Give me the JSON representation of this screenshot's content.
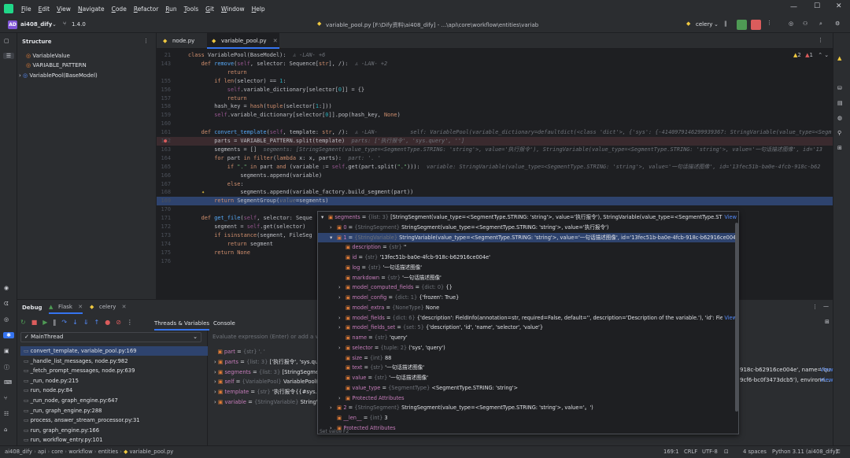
{
  "menu": [
    "File",
    "Edit",
    "View",
    "Navigate",
    "Code",
    "Refactor",
    "Run",
    "Tools",
    "Git",
    "Window",
    "Help"
  ],
  "project": {
    "badge": "AD",
    "name": "ai408_dify",
    "branch": "1.4.0"
  },
  "window_title": "variable_pool.py [F:\\Dify资料\\ai408_dify] - ...\\api\\core\\workflow\\entities\\variable_pool.py",
  "run_config": "celery",
  "colors": {
    "accent": "#3574f0",
    "breakpoint": "#db5c5c",
    "run_green": "#4e9a54",
    "stop_red": "#db5c5c"
  },
  "structure": {
    "title": "Structure",
    "items": [
      {
        "icon": "field-icon",
        "label": "VariableValue"
      },
      {
        "icon": "field-icon",
        "label": "VARIABLE_PATTERN"
      },
      {
        "icon": "class-icon",
        "label": "VariablePool(BaseModel)"
      }
    ]
  },
  "tabs": [
    {
      "label": "node.py"
    },
    {
      "label": "variable_pool.py"
    }
  ],
  "editor": {
    "warnings": "2",
    "errors": "1",
    "lines": [
      {
        "n": "21",
        "html": "<span class='kw'>class</span> VariablePool(BaseModel):  <span class='hint'>♙ -LAN- +6</span>"
      },
      {
        "n": "143",
        "html": "    <span class='kw'>def</span> <span class='fn'>remove</span>(<span class='sf'>self</span>, selector: Sequence[<span class='kw'>str</span>], /):  <span class='hint'>♙ -LAN- +2</span>"
      },
      {
        "n": "",
        "html": "            <span class='kw'>return</span>"
      },
      {
        "n": "155",
        "html": "        <span class='kw'>if</span> <span class='kw'>len</span>(selector) == <span class='nm'>1</span>:"
      },
      {
        "n": "156",
        "html": "            <span class='sf'>self</span>.variable_dictionary[selector[<span class='nm'>0</span>]] = {}"
      },
      {
        "n": "157",
        "html": "            <span class='kw'>return</span>"
      },
      {
        "n": "158",
        "html": "        hash_key = <span class='kw'>hash</span>(<span class='kw'>tuple</span>(selector[<span class='nm'>1</span>:]))"
      },
      {
        "n": "159",
        "html": "        <span class='sf'>self</span>.variable_dictionary[selector[<span class='nm'>0</span>]].pop(hash_key, <span class='kw'>None</span>)"
      },
      {
        "n": "160",
        "html": ""
      },
      {
        "n": "161",
        "html": "    <span class='kw'>def</span> <span class='fn'>convert_template</span>(<span class='sf'>self</span>, template: <span class='kw'>str</span>, /):  <span class='hint'>♙ -LAN-</span>          <span class='hint'>self: VariablePool(variable_dictionary=defaultdict(&lt;class 'dict'&gt;, {'sys': {-4140979146299939367: StringVariable(value_type=&lt;Segm</span>"
      },
      {
        "n": "162",
        "html": "        parts = VARIABLE_PATTERN.split(template)  <span class='hint'>parts: ['执行报令', 'sys.query', '']</span>",
        "cls": "hl",
        "bp": true
      },
      {
        "n": "163",
        "html": "        segments = []  <span class='hint'>segments: [StringSegment(value_type=&lt;SegmentType.STRING: 'string'&gt;, value='执行报令'), StringVariable(value_type=&lt;SegmentType.STRING: 'string'&gt;, value='一句话描述图像', id='13</span>"
      },
      {
        "n": "164",
        "html": "        <span class='kw'>for</span> part <span class='kw'>in</span> <span class='kw'>filter</span>(<span class='kw'>lambda</span> x: x, parts):  <span class='hint'>part: '. '</span>"
      },
      {
        "n": "165",
        "html": "            <span class='kw'>if</span> <span class='st'>\".\"</span> <span class='kw'>in</span> part <span class='kw'>and</span> (variable := <span class='sf'>self</span>.get(part.split(<span class='st'>\".\"</span>))):  <span class='hint'>variable: StringVariable(value_type=&lt;SegmentType.STRING: 'string'&gt;, value='一句话描述图像', id='13fec51b-ba0e-4fcb-918c-b62</span>"
      },
      {
        "n": "166",
        "html": "                segments.append(variable)"
      },
      {
        "n": "167",
        "html": "            <span class='kw'>else</span>:"
      },
      {
        "n": "168",
        "html": "                segments.append(variable_factory.build_segment(part))",
        "bulb": true
      },
      {
        "n": "169",
        "html": "        <span class='kw'>return</span> SegmentGroup(<span class='hint'>value</span>=segments)",
        "cls": "exec"
      },
      {
        "n": "170",
        "html": ""
      },
      {
        "n": "171",
        "html": "    <span class='kw'>def</span> <span class='fn'>get_file</span>(<span class='sf'>self</span>, selector: Seque"
      },
      {
        "n": "172",
        "html": "        segment = <span class='sf'>self</span>.get(selector)"
      },
      {
        "n": "173",
        "html": "        <span class='kw'>if</span> <span class='kw'>isinstance</span>(segment, FileSeg"
      },
      {
        "n": "174",
        "html": "            <span class='kw'>return</span> segment"
      },
      {
        "n": "175",
        "html": "        <span class='kw'>return</span> <span class='kw'>None</span>"
      },
      {
        "n": "176",
        "html": ""
      }
    ]
  },
  "debug": {
    "title": "Debug",
    "tabs": [
      {
        "label": "Flask"
      },
      {
        "label": "celery"
      }
    ],
    "subtabs": [
      "Threads & Variables",
      "Console"
    ],
    "thread": "MainThread",
    "eval_placeholder": "Evaluate expression (Enter) or add a watch (Ctrl+Shift+Enter)",
    "frames": [
      "convert_template, variable_pool.py:169",
      "_handle_list_messages, node.py:982",
      "_fetch_prompt_messages, node.py:639",
      "_run, node.py:215",
      "run, node.py:84",
      "_run_node, graph_engine.py:647",
      "_run, graph_engine.py:288",
      "process, answer_stream_processor.py:31",
      "run, graph_engine.py:166",
      "run, workflow_entry.py:101"
    ],
    "vars": [
      {
        "name": "part",
        "type": "{str} '. '",
        "value": ""
      },
      {
        "name": "parts",
        "type": "{list: 3}",
        "value": "['执行报令', 'sys.query', '']"
      },
      {
        "name": "segments",
        "type": "{list: 3}",
        "value": "[StringSegmen"
      },
      {
        "name": "self",
        "type": "{VariablePool}",
        "value": "VariablePool(\\"
      },
      {
        "name": "template",
        "type": "{str}",
        "value": "'执行报令{{#sys.que"
      },
      {
        "name": "variable",
        "type": "{StringVariable}",
        "value": "StringVar"
      }
    ],
    "vars_right": [
      {
        "value": "918c-b62916ce004e', name='qu",
        "view": "View"
      },
      {
        "value": "9cf6-bc0f3473dcb5'), environn...",
        "view": "View"
      }
    ]
  },
  "popup": {
    "rows": [
      {
        "indent": 0,
        "arrow": "▾",
        "name": "segments",
        "type": "{list: 3}",
        "value": "[StringSegment(value_type=<SegmentType.STRING: 'string'>, value='执行报令'), StringVariable(value_type=<SegmentType.STRING: 'string'...",
        "view": "View"
      },
      {
        "indent": 1,
        "arrow": "›",
        "name": "0",
        "type": "{StringSegment}",
        "value": "StringSegment(value_type=<SegmentType.STRING: 'string'>, value='执行报令')",
        "view": ""
      },
      {
        "indent": 1,
        "arrow": "▾",
        "name": "1",
        "type": "{StringVariable}",
        "value": "StringVariable(value_type=<SegmentType.STRING: 'string'>, value='一句话描述图像', id='13fec51b-ba0e-4fcb-918c-b62916ce004e', name='query'...",
        "view": "",
        "sel": true
      },
      {
        "indent": 2,
        "arrow": "",
        "name": "description",
        "type": "{str}",
        "value": "''",
        "view": ""
      },
      {
        "indent": 2,
        "arrow": "",
        "name": "id",
        "type": "{str}",
        "value": "'13fec51b-ba0e-4fcb-918c-b62916ce004e'",
        "view": ""
      },
      {
        "indent": 2,
        "arrow": "",
        "name": "log",
        "type": "{str}",
        "value": "'一句话描述图像'",
        "view": ""
      },
      {
        "indent": 2,
        "arrow": "",
        "name": "markdown",
        "type": "{str}",
        "value": "'一句话描述图像'",
        "view": ""
      },
      {
        "indent": 2,
        "arrow": "›",
        "name": "model_computed_fields",
        "type": "{dict: 0}",
        "value": "{}",
        "view": ""
      },
      {
        "indent": 2,
        "arrow": "›",
        "name": "model_config",
        "type": "{dict: 1}",
        "value": "{'frozen': True}",
        "view": ""
      },
      {
        "indent": 2,
        "arrow": "",
        "name": "model_extra",
        "type": "{NoneType}",
        "value": "None",
        "view": ""
      },
      {
        "indent": 2,
        "arrow": "›",
        "name": "model_fields",
        "type": "{dict: 6}",
        "value": "{'description': FieldInfo(annotation=str, required=False, default='', description='Description of the variable.'), 'id': FieldInfo(annota...",
        "view": "View"
      },
      {
        "indent": 2,
        "arrow": "›",
        "name": "model_fields_set",
        "type": "{set: 5}",
        "value": "{'description', 'id', 'name', 'selector', 'value'}",
        "view": ""
      },
      {
        "indent": 2,
        "arrow": "",
        "name": "name",
        "type": "{str}",
        "value": "'query'",
        "view": ""
      },
      {
        "indent": 2,
        "arrow": "›",
        "name": "selector",
        "type": "{tuple: 2}",
        "value": "('sys', 'query')",
        "view": ""
      },
      {
        "indent": 2,
        "arrow": "",
        "name": "size",
        "type": "{int}",
        "value": "88",
        "view": ""
      },
      {
        "indent": 2,
        "arrow": "",
        "name": "text",
        "type": "{str}",
        "value": "'一句话描述图像'",
        "view": ""
      },
      {
        "indent": 2,
        "arrow": "",
        "name": "value",
        "type": "{str}",
        "value": "'一句话描述图像'",
        "view": ""
      },
      {
        "indent": 2,
        "arrow": "",
        "name": "value_type",
        "type": "{SegmentType}",
        "value": "<SegmentType.STRING: 'string'>",
        "view": ""
      },
      {
        "indent": 2,
        "arrow": "›",
        "name": "Protected Attributes",
        "type": "",
        "value": "",
        "view": ""
      },
      {
        "indent": 1,
        "arrow": "›",
        "name": "2",
        "type": "{StringSegment}",
        "value": "StringSegment(value_type=<SegmentType.STRING: 'string'>, value='。')",
        "view": ""
      },
      {
        "indent": 1,
        "arrow": "",
        "name": "__len__",
        "type": "{int}",
        "value": "3",
        "view": ""
      },
      {
        "indent": 1,
        "arrow": "›",
        "name": "Protected Attributes",
        "type": "",
        "value": "",
        "view": ""
      }
    ],
    "footer": "Set value  F2"
  },
  "status": {
    "breadcrumb": [
      "ai408_dify",
      "api",
      "core",
      "workflow",
      "entities",
      "variable_pool.py"
    ],
    "position": "169:1",
    "line_sep": "CRLF",
    "encoding": "UTF-8",
    "indent": "4 spaces",
    "interpreter": "Python 3.11 (ai408_dify)"
  }
}
